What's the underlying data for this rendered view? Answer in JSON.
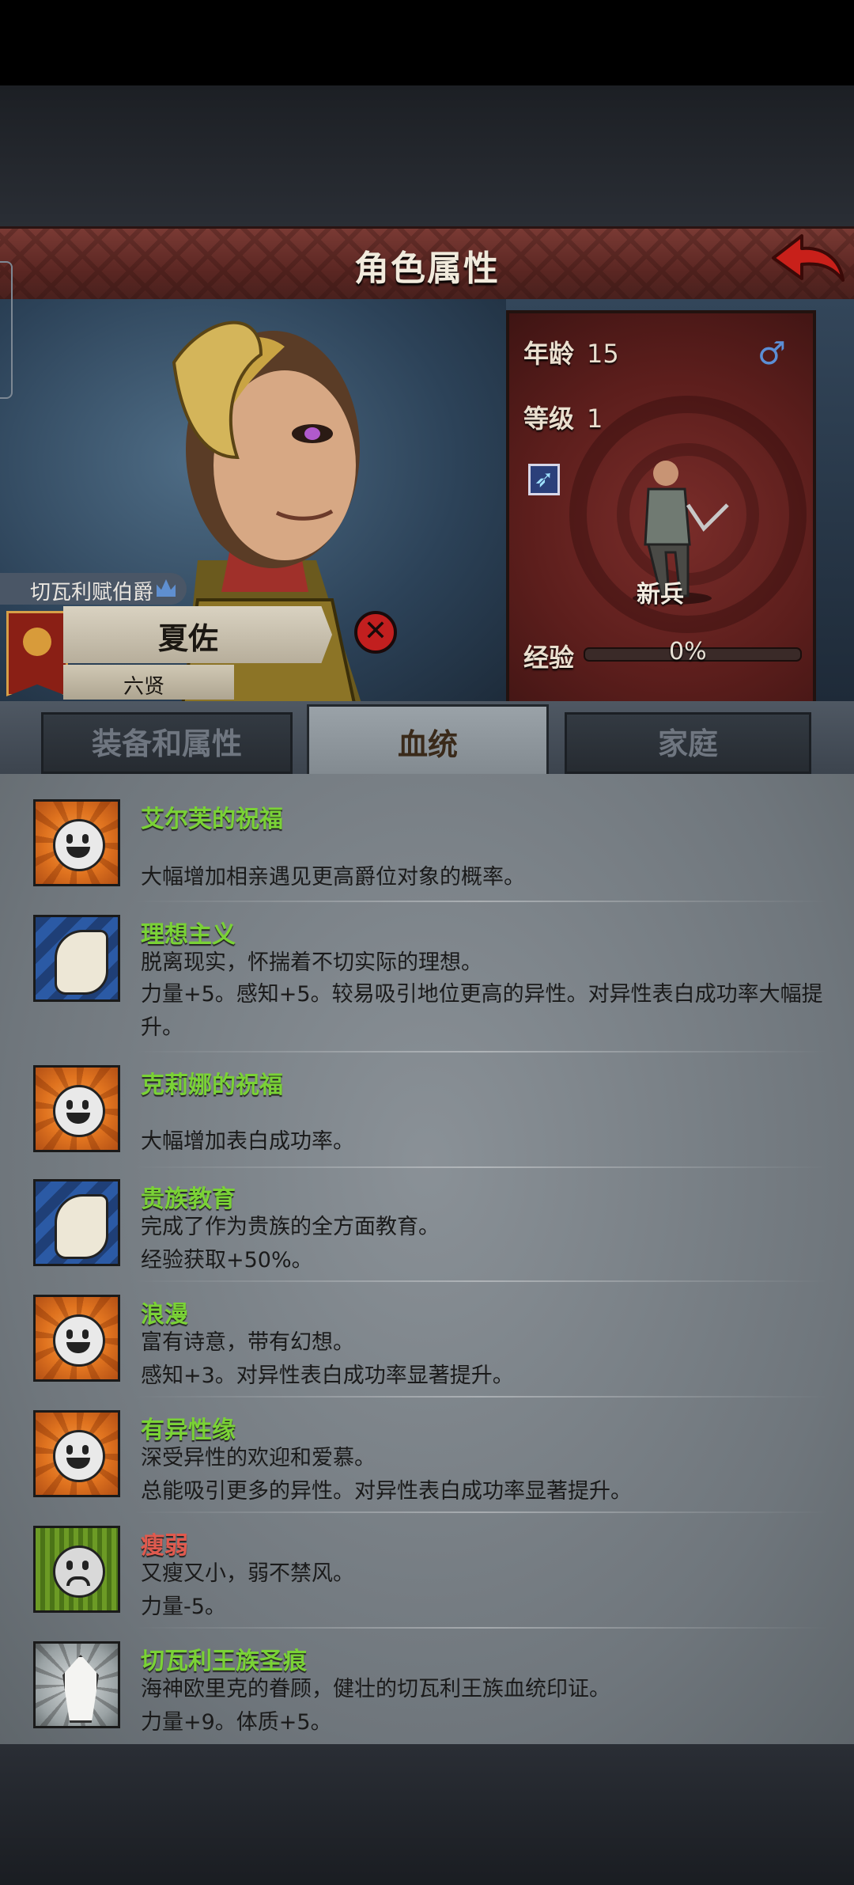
{
  "header": {
    "title": "角色属性"
  },
  "character": {
    "age_label": "年龄",
    "age": "15",
    "level_label": "等级",
    "level": "1",
    "gender_symbol": "♂",
    "unit_type": "新兵",
    "exp_label": "经验",
    "exp_value": "0%",
    "exp_fraction": 0,
    "title": "切瓦利赋伯爵",
    "name": "夏佐",
    "subtitle": "六贤"
  },
  "tabs": [
    {
      "label": "装备和属性",
      "active": false
    },
    {
      "label": "血统",
      "active": true
    },
    {
      "label": "家庭",
      "active": false
    }
  ],
  "traits": [
    {
      "name": "艾尔芙的祝福",
      "type": "positive",
      "icon": "happy-sun-icon",
      "desc1": "",
      "desc2": "大幅增加相亲遇见更高爵位对象的概率。"
    },
    {
      "name": "理想主义",
      "type": "positive",
      "icon": "flexed-arm-icon",
      "desc1": "脱离现实，怀揣着不切实际的理想。",
      "desc2": "力量+5。感知+5。较易吸引地位更高的异性。对异性表白成功率大幅提升。"
    },
    {
      "name": "克莉娜的祝福",
      "type": "positive",
      "icon": "happy-sun-icon",
      "desc1": "",
      "desc2": "大幅增加表白成功率。"
    },
    {
      "name": "贵族教育",
      "type": "positive",
      "icon": "flexed-arm-icon",
      "desc1": "完成了作为贵族的全方面教育。",
      "desc2": "经验获取+50%。"
    },
    {
      "name": "浪漫",
      "type": "positive",
      "icon": "happy-sun-icon",
      "desc1": "富有诗意，带有幻想。",
      "desc2": "感知+3。对异性表白成功率显著提升。"
    },
    {
      "name": "有异性缘",
      "type": "positive",
      "icon": "happy-sun-icon",
      "desc1": "深受异性的欢迎和爱慕。",
      "desc2": "总能吸引更多的异性。对异性表白成功率显著提升。"
    },
    {
      "name": "瘦弱",
      "type": "negative",
      "icon": "sad-face-icon",
      "desc1": "又瘦又小，弱不禁风。",
      "desc2": "力量-5。"
    },
    {
      "name": "切瓦利王族圣痕",
      "type": "positive",
      "icon": "royal-crest-icon",
      "desc1": "海神欧里克的眷顾，健壮的切瓦利王族血统印证。",
      "desc2": "力量+9。体质+5。"
    }
  ]
}
